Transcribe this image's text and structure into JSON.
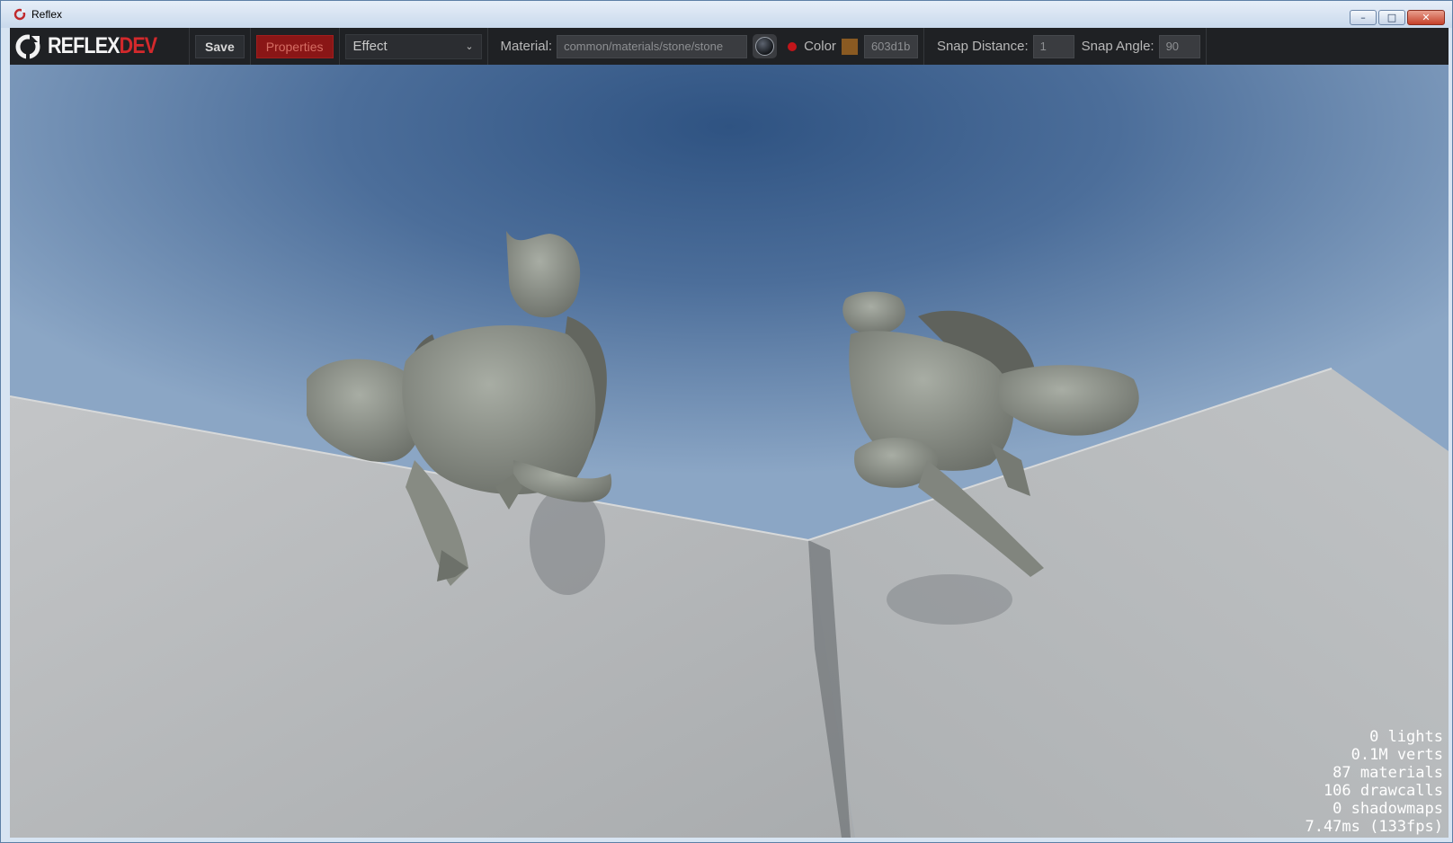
{
  "window": {
    "title": "Reflex",
    "controls": {
      "minimize": "–",
      "maximize": "□",
      "close": "✕"
    }
  },
  "toolbar": {
    "logo": {
      "part1": "REFLEX",
      "part2": "DEV"
    },
    "save_label": "Save",
    "properties_label": "Properties",
    "effect_dropdown": {
      "selected": "Effect"
    },
    "material_label": "Material:",
    "material_value": "common/materials/stone/stone",
    "color_label": "Color",
    "color_hex": "603d1b",
    "color_swatch": "#8a5a22",
    "snap_distance_label": "Snap Distance:",
    "snap_distance_value": "1",
    "snap_angle_label": "Snap Angle:",
    "snap_angle_value": "90"
  },
  "stats": [
    {
      "text": "0 lights"
    },
    {
      "text": "0.1M verts"
    },
    {
      "text": "87 materials"
    },
    {
      "text": "106 drawcalls"
    },
    {
      "text": "0 shadowmaps"
    },
    {
      "text": "7.47ms (133fps)"
    }
  ],
  "colors": {
    "toolbar_bg": "#1f2124",
    "accent_red": "#d3292c",
    "wall": "#b9bcbe",
    "statue": "#8f948c"
  },
  "icons": [
    "reflex-logo-icon",
    "material-sphere-icon",
    "chevron-down-icon",
    "red-dot-icon"
  ]
}
